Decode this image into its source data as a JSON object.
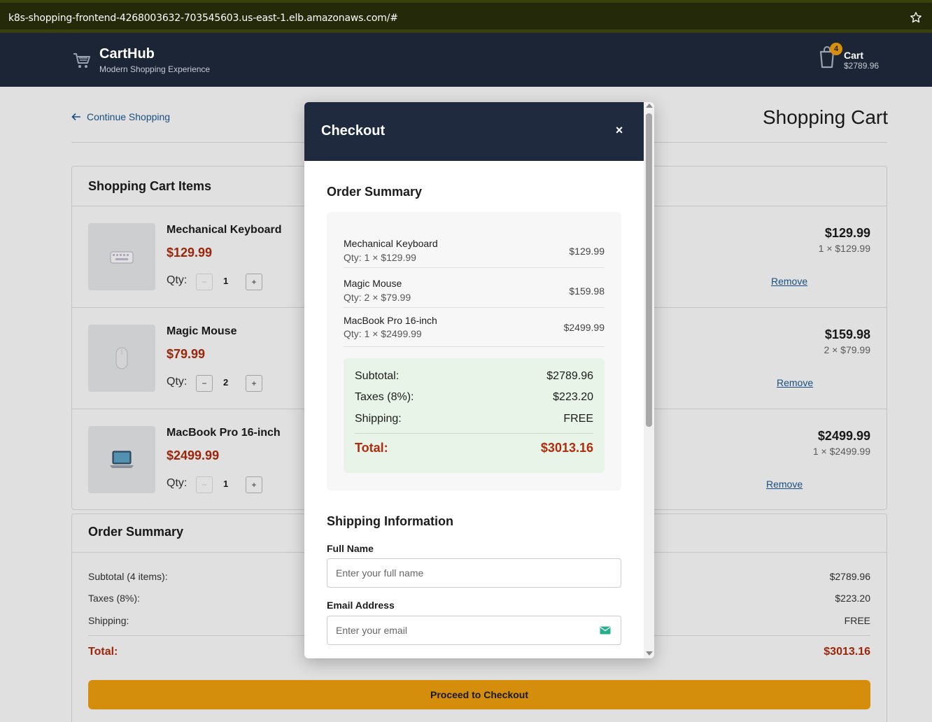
{
  "browser": {
    "url": "k8s-shopping-frontend-4268003632-703545603.us-east-1.elb.amazonaws.com/#"
  },
  "header": {
    "brand": "CartHub",
    "tagline": "Modern Shopping Experience",
    "cart_count": "4",
    "cart_label": "Cart",
    "cart_total": "$2789.96"
  },
  "page": {
    "continue_label": "Continue Shopping",
    "title": "Shopping Cart"
  },
  "cart": {
    "title": "Shopping Cart Items",
    "qty_label": "Qty:",
    "remove_label": "Remove",
    "items": [
      {
        "name": "Mechanical Keyboard",
        "price": "$129.99",
        "qty": "1",
        "line_total": "$129.99",
        "breakdown": "1 × $129.99",
        "icon": "keyboard-icon"
      },
      {
        "name": "Magic Mouse",
        "price": "$79.99",
        "qty": "2",
        "line_total": "$159.98",
        "breakdown": "2 × $79.99",
        "icon": "mouse-icon"
      },
      {
        "name": "MacBook Pro 16-inch",
        "price": "$2499.99",
        "qty": "1",
        "line_total": "$2499.99",
        "breakdown": "1 × $2499.99",
        "icon": "laptop-icon"
      }
    ]
  },
  "summary": {
    "title": "Order Summary",
    "subtotal_label": "Subtotal (4 items):",
    "subtotal": "$2789.96",
    "tax_label": "Taxes (8%):",
    "tax": "$223.20",
    "shipping_label": "Shipping:",
    "shipping": "FREE",
    "total_label": "Total:",
    "total": "$3013.16",
    "checkout_button": "Proceed to Checkout"
  },
  "modal": {
    "title": "Checkout",
    "close": "×",
    "order_summary_title": "Order Summary",
    "items": [
      {
        "name": "Mechanical Keyboard",
        "qty": "Qty: 1 × $129.99",
        "amount": "$129.99"
      },
      {
        "name": "Magic Mouse",
        "qty": "Qty: 2 × $79.99",
        "amount": "$159.98"
      },
      {
        "name": "MacBook Pro 16-inch",
        "qty": "Qty: 1 × $2499.99",
        "amount": "$2499.99"
      }
    ],
    "subtotal_label": "Subtotal:",
    "subtotal": "$2789.96",
    "tax_label": "Taxes (8%):",
    "tax": "$223.20",
    "shipping_label": "Shipping:",
    "shipping": "FREE",
    "total_label": "Total:",
    "total": "$3013.16",
    "shipping_title": "Shipping Information",
    "full_name_label": "Full Name",
    "full_name_placeholder": "Enter your full name",
    "email_label": "Email Address",
    "email_placeholder": "Enter your email"
  },
  "colors": {
    "header_bg": "#1b2536",
    "accent": "#f2a20e",
    "price_red": "#b12c0c",
    "link_blue": "#1d5a94",
    "totals_bg": "#e8f4e8"
  }
}
